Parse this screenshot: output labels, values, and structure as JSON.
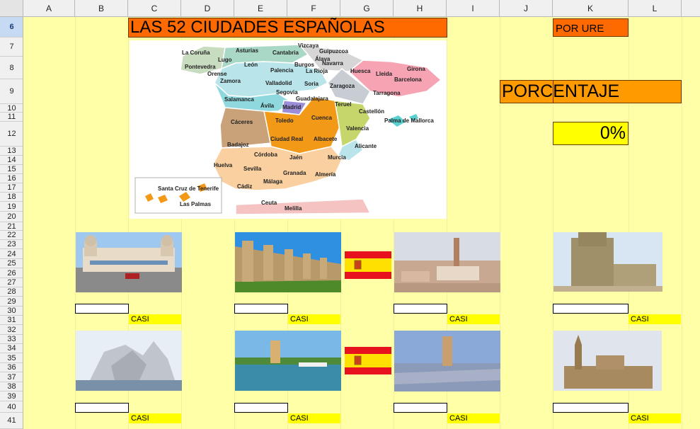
{
  "columns": [
    "A",
    "B",
    "C",
    "D",
    "E",
    "F",
    "G",
    "H",
    "I",
    "J",
    "K",
    "L"
  ],
  "rows": [
    "6",
    "7",
    "8",
    "9",
    "10",
    "11",
    "12",
    "13",
    "14",
    "15",
    "16",
    "17",
    "18",
    "19",
    "20",
    "21",
    "22",
    "23",
    "24",
    "25",
    "26",
    "27",
    "28",
    "29",
    "30",
    "31",
    "32",
    "33",
    "34",
    "35",
    "36",
    "37",
    "38",
    "39",
    "40",
    "41"
  ],
  "selected_row": "6",
  "title": "LAS 52 CIUDADES ESPAÑOLAS",
  "por_ure": "POR URE",
  "porcentaje_label": "PORCENTAJE",
  "percentage_value": "0%",
  "map": {
    "cities": [
      "La Coruña",
      "Lugo",
      "Pontevedra",
      "Orense",
      "Asturias",
      "Cantabria",
      "Vizcaya",
      "Guipuzcoa",
      "Álava",
      "Navarra",
      "León",
      "Burgos",
      "Palencia",
      "La Rioja",
      "Huesca",
      "Lleida",
      "Girona",
      "Barcelona",
      "Zamora",
      "Valladolid",
      "Soria",
      "Zaragoza",
      "Tarragona",
      "Segovia",
      "Guadalajara",
      "Salamanca",
      "Ávila",
      "Madrid",
      "Teruel",
      "Castellón",
      "Cáceres",
      "Toledo",
      "Cuenca",
      "Valencia",
      "Palma de Mallorca",
      "Badajoz",
      "Ciudad Real",
      "Albacete",
      "Alicante",
      "Huelva",
      "Córdoba",
      "Jaén",
      "Murcia",
      "Sevilla",
      "Granada",
      "Almería",
      "Málaga",
      "Cádiz",
      "Santa Cruz de Tenerife",
      "Las Palmas",
      "Ceuta",
      "Melilla"
    ]
  },
  "quiz": {
    "casi_label": "CASI",
    "answers": [
      "",
      "",
      "",
      "",
      "",
      "",
      "",
      ""
    ]
  },
  "colors": {
    "orange": "#ff6a00",
    "orange_light": "#ff9a00",
    "yellow": "#ffff00",
    "sheet_bg": "#ffffa8"
  }
}
